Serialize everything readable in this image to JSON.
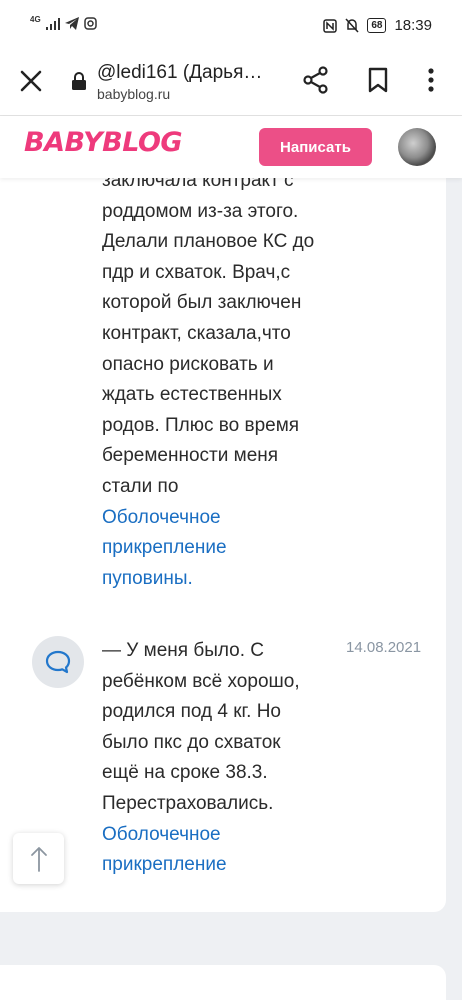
{
  "status_bar": {
    "network": "4G",
    "battery": "68",
    "time": "18:39"
  },
  "browser": {
    "title": "@ledi161 (Дарья…",
    "domain": "babyblog.ru"
  },
  "site": {
    "logo": "BABYBLOG",
    "write_button": "Написать",
    "brand_color": "#ec4f87"
  },
  "comment": {
    "lines": [
      "заключала контракт с",
      "роддомом из-за этого.",
      "Делали плановое КС до",
      "пдр и схваток. Врач,с",
      "которой был заключен",
      "контракт, сказала,что",
      "опасно рисковать и",
      "ждать естественных",
      "родов. Плюс во время",
      "беременности меня",
      "стали по"
    ],
    "link_lines": [
      "Оболочечное",
      "прикрепление",
      "пуповины."
    ]
  },
  "reply": {
    "date": "14.08.2021",
    "lines": [
      "— У меня было. С",
      "ребёнком всё хорошо,",
      "родился под 4 кг. Но",
      "было пкс до схваток",
      "ещё на сроке 38.3.",
      "Перестраховались."
    ],
    "link_lines": [
      "Оболочечное",
      "прикрепление"
    ]
  }
}
